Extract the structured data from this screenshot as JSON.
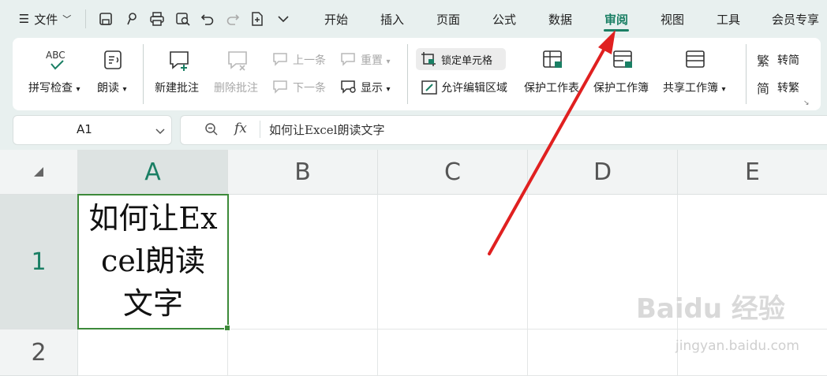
{
  "menu": {
    "file_label": "文件",
    "tabs": [
      "开始",
      "插入",
      "页面",
      "公式",
      "数据",
      "审阅",
      "视图",
      "工具",
      "会员专享"
    ],
    "active_tab": "审阅"
  },
  "ribbon": {
    "spell_check": "拼写检查",
    "read_aloud": "朗读",
    "new_comment": "新建批注",
    "delete_comment": "删除批注",
    "prev_item": "上一条",
    "next_item": "下一条",
    "redo_item": "重置",
    "show": "显示",
    "lock_cell": "锁定单元格",
    "allow_edit_range": "允许编辑区域",
    "protect_sheet": "保护工作表",
    "protect_workbook": "保护工作簿",
    "share_workbook": "共享工作簿",
    "to_traditional": "转简",
    "to_simplified": "转繁",
    "abc_text": "ABC"
  },
  "formula_bar": {
    "name_box": "A1",
    "fx": "fx",
    "content": "如何让Excel朗读文字"
  },
  "sheet": {
    "columns": [
      "A",
      "B",
      "C",
      "D",
      "E"
    ],
    "rows": [
      "1",
      "2"
    ],
    "cell_a1": "如何让Excel朗读文字"
  },
  "watermark": {
    "brand": "Baidu 经验",
    "url": "jingyan.baidu.com"
  },
  "colors": {
    "accent": "#1a7f64",
    "arrow": "#e02020",
    "selection": "#3d8a3a"
  }
}
